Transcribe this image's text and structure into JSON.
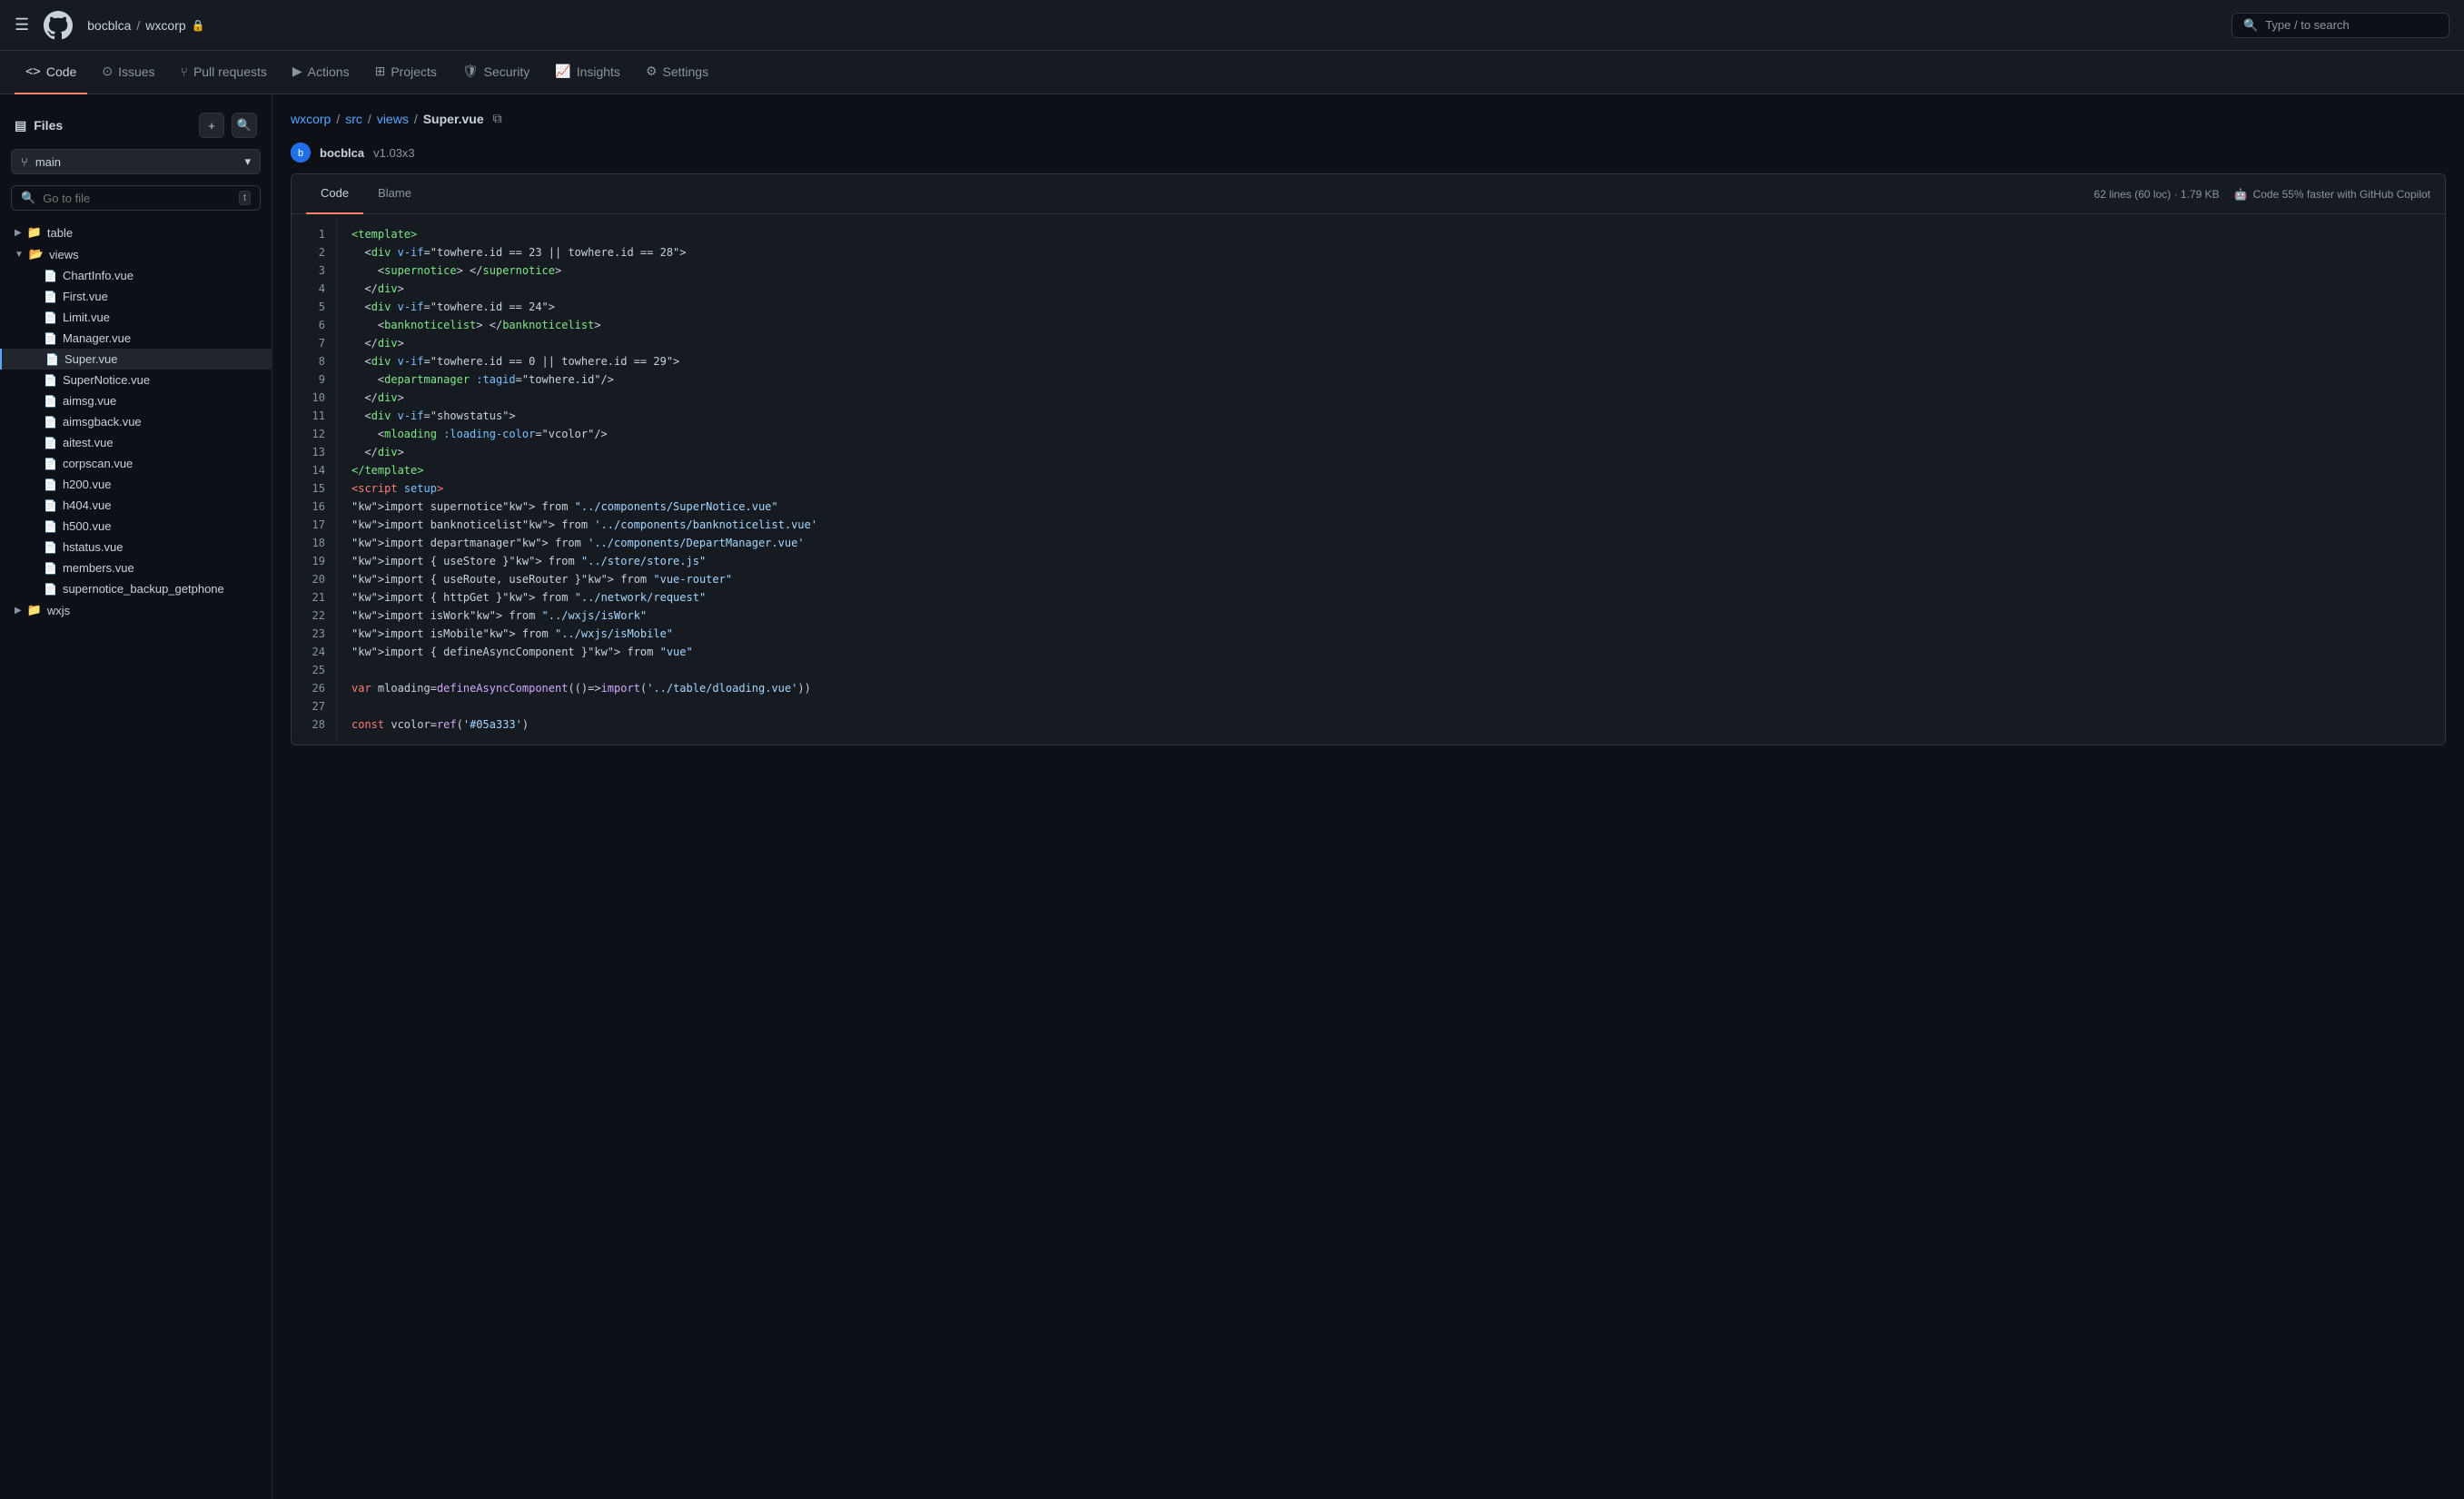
{
  "topNav": {
    "owner": "bocblca",
    "sep": "/",
    "repo": "wxcorp",
    "lockIcon": "🔒",
    "searchPlaceholder": "Type / to search"
  },
  "repoTabs": [
    {
      "id": "code",
      "label": "Code",
      "icon": "<>",
      "active": true
    },
    {
      "id": "issues",
      "label": "Issues",
      "icon": "⊙",
      "active": false
    },
    {
      "id": "pull-requests",
      "label": "Pull requests",
      "icon": "⑂",
      "active": false
    },
    {
      "id": "actions",
      "label": "Actions",
      "icon": "▶",
      "active": false
    },
    {
      "id": "projects",
      "label": "Projects",
      "icon": "⊞",
      "active": false
    },
    {
      "id": "security",
      "label": "Security",
      "icon": "🛡",
      "active": false
    },
    {
      "id": "insights",
      "label": "Insights",
      "icon": "📈",
      "active": false
    },
    {
      "id": "settings",
      "label": "Settings",
      "icon": "⚙",
      "active": false
    }
  ],
  "sidebar": {
    "title": "Files",
    "branch": "main",
    "searchPlaceholder": "Go to file",
    "shortcut": "t",
    "treeItems": [
      {
        "id": "table-folder",
        "type": "folder",
        "name": "table",
        "indent": 0,
        "collapsed": true
      },
      {
        "id": "views-folder",
        "type": "folder",
        "name": "views",
        "indent": 0,
        "collapsed": false
      },
      {
        "id": "chartinfo-vue",
        "type": "file",
        "name": "ChartInfo.vue",
        "indent": 1
      },
      {
        "id": "first-vue",
        "type": "file",
        "name": "First.vue",
        "indent": 1
      },
      {
        "id": "limit-vue",
        "type": "file",
        "name": "Limit.vue",
        "indent": 1
      },
      {
        "id": "manager-vue",
        "type": "file",
        "name": "Manager.vue",
        "indent": 1
      },
      {
        "id": "super-vue",
        "type": "file",
        "name": "Super.vue",
        "indent": 1,
        "active": true
      },
      {
        "id": "supernotice-vue",
        "type": "file",
        "name": "SuperNotice.vue",
        "indent": 1
      },
      {
        "id": "aimsg-vue",
        "type": "file",
        "name": "aimsg.vue",
        "indent": 1
      },
      {
        "id": "aimsgback-vue",
        "type": "file",
        "name": "aimsgback.vue",
        "indent": 1
      },
      {
        "id": "aitest-vue",
        "type": "file",
        "name": "aitest.vue",
        "indent": 1
      },
      {
        "id": "corpscan-vue",
        "type": "file",
        "name": "corpscan.vue",
        "indent": 1
      },
      {
        "id": "h200-vue",
        "type": "file",
        "name": "h200.vue",
        "indent": 1
      },
      {
        "id": "h404-vue",
        "type": "file",
        "name": "h404.vue",
        "indent": 1
      },
      {
        "id": "h500-vue",
        "type": "file",
        "name": "h500.vue",
        "indent": 1
      },
      {
        "id": "hstatus-vue",
        "type": "file",
        "name": "hstatus.vue",
        "indent": 1
      },
      {
        "id": "members-vue",
        "type": "file",
        "name": "members.vue",
        "indent": 1
      },
      {
        "id": "supernotice-backup",
        "type": "file",
        "name": "supernotice_backup_getphone",
        "indent": 1
      },
      {
        "id": "wxjs-folder",
        "type": "folder",
        "name": "wxjs",
        "indent": 0,
        "collapsed": true
      }
    ]
  },
  "filePath": {
    "parts": [
      "wxcorp",
      "src",
      "views",
      "Super.vue"
    ]
  },
  "commitInfo": {
    "author": "bocblca",
    "version": "v1.03x3",
    "avatarInitial": "b"
  },
  "codeViewer": {
    "tabs": [
      {
        "id": "code",
        "label": "Code",
        "active": true
      },
      {
        "id": "blame",
        "label": "Blame",
        "active": false
      }
    ],
    "meta": "62 lines (60 loc) · 1.79 KB",
    "copilot": "Code 55% faster with GitHub Copilot",
    "lines": [
      {
        "num": 1,
        "content": "<template>"
      },
      {
        "num": 2,
        "content": "  <div v-if=\"towhere.id == 23 || towhere.id == 28\">"
      },
      {
        "num": 3,
        "content": "    <supernotice> </supernotice>"
      },
      {
        "num": 4,
        "content": "  </div>"
      },
      {
        "num": 5,
        "content": "  <div v-if=\"towhere.id == 24\">"
      },
      {
        "num": 6,
        "content": "    <banknoticelist> </banknoticelist>"
      },
      {
        "num": 7,
        "content": "  </div>"
      },
      {
        "num": 8,
        "content": "  <div v-if=\"towhere.id == 0 || towhere.id == 29\">"
      },
      {
        "num": 9,
        "content": "    <departmanager :tagid=\"towhere.id\"/>"
      },
      {
        "num": 10,
        "content": "  </div>"
      },
      {
        "num": 11,
        "content": "  <div v-if=\"showstatus\">"
      },
      {
        "num": 12,
        "content": "    <mloading :loading-color=\"vcolor\"/>"
      },
      {
        "num": 13,
        "content": "  </div>"
      },
      {
        "num": 14,
        "content": "</template>"
      },
      {
        "num": 15,
        "content": "<script setup>"
      },
      {
        "num": 16,
        "content": "import supernotice from \"../components/SuperNotice.vue\""
      },
      {
        "num": 17,
        "content": "import banknoticelist from '../components/banknoticelist.vue'"
      },
      {
        "num": 18,
        "content": "import departmanager from '../components/DepartManager.vue'"
      },
      {
        "num": 19,
        "content": "import { useStore } from \"../store/store.js\""
      },
      {
        "num": 20,
        "content": "import { useRoute, useRouter } from \"vue-router\""
      },
      {
        "num": 21,
        "content": "import { httpGet } from \"../network/request\""
      },
      {
        "num": 22,
        "content": "import isWork from \"../wxjs/isWork\""
      },
      {
        "num": 23,
        "content": "import isMobile from \"../wxjs/isMobile\""
      },
      {
        "num": 24,
        "content": "import { defineAsyncComponent } from \"vue\""
      },
      {
        "num": 25,
        "content": ""
      },
      {
        "num": 26,
        "content": "var mloading=defineAsyncComponent(()=>import('../table/dloading.vue'))"
      },
      {
        "num": 27,
        "content": ""
      },
      {
        "num": 28,
        "content": "const vcolor=ref('#05a333')"
      }
    ]
  }
}
